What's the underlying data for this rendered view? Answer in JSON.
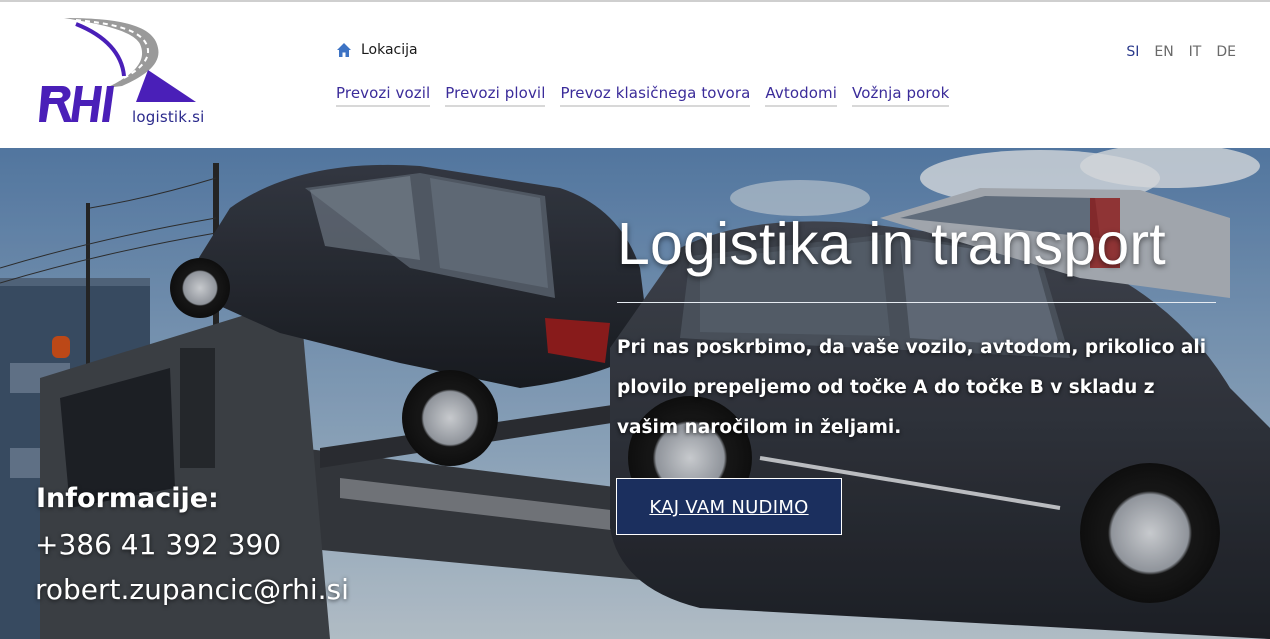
{
  "header": {
    "logo": {
      "text": "RHI",
      "domain": "logistik.si"
    },
    "home_link": {
      "label": "Lokacija",
      "icon": "home-icon"
    },
    "nav": [
      {
        "label": "Prevozi vozil"
      },
      {
        "label": "Prevozi plovil"
      },
      {
        "label": "Prevoz klasičnega tovora"
      },
      {
        "label": "Avtodomi"
      },
      {
        "label": "Vožnja porok"
      }
    ],
    "languages": [
      {
        "label": "SI",
        "active": true
      },
      {
        "label": "EN",
        "active": false
      },
      {
        "label": "IT",
        "active": false
      },
      {
        "label": "DE",
        "active": false
      }
    ]
  },
  "hero": {
    "title": "Logistika in transport",
    "text": "Pri nas poskrbimo, da vaše vozilo, avtodom, prikolico ali plovilo prepeljemo od točke A do točke B v skladu z vašim naročilom in željami.",
    "cta_label": "KAJ VAM NUDIMO"
  },
  "contact": {
    "title": "Informacije:",
    "phone": "+386 41 392 390",
    "email": "robert.zupancic@rhi.si"
  },
  "colors": {
    "brand_purple": "#4a1fb8",
    "nav_link": "#3b2c9a",
    "cta_background": "#1b2f5e"
  }
}
